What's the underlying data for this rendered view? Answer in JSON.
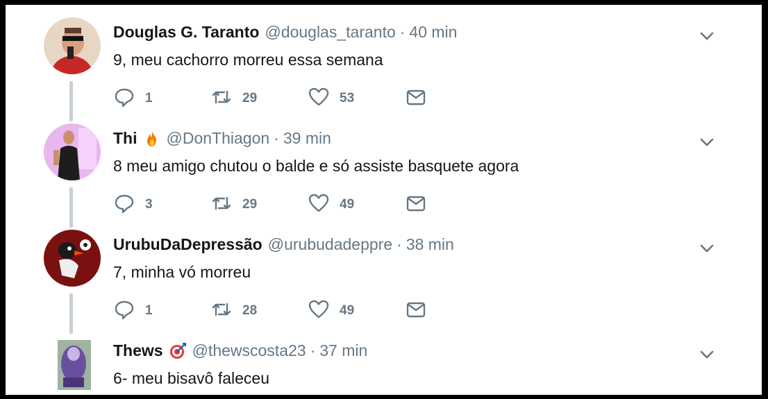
{
  "tweets": [
    {
      "name": "Douglas G. Taranto",
      "handle": "@douglas_taranto",
      "separator": "·",
      "time": "40 min",
      "text": "9, meu cachorro morreu essa semana",
      "replies": "1",
      "retweets": "29",
      "likes": "53",
      "badge": null
    },
    {
      "name": "Thi",
      "handle": "@DonThiagon",
      "separator": "·",
      "time": "39 min",
      "text": "8 meu amigo chutou o balde e só assiste basquete agora",
      "replies": "3",
      "retweets": "29",
      "likes": "49",
      "badge": "fire-emoji-icon"
    },
    {
      "name": "UrubuDaDepressão",
      "handle": "@urubudadeppre",
      "separator": "·",
      "time": "38 min",
      "text": "7, minha vó morreu",
      "replies": "1",
      "retweets": "28",
      "likes": "49",
      "badge": null
    },
    {
      "name": "Thews",
      "handle": "@thewscosta23",
      "separator": "·",
      "time": "37 min",
      "text": "6- meu bisavô faleceu",
      "badge": "target-emoji-icon"
    }
  ],
  "colors": {
    "accent_gray": "#657786",
    "text": "#14171a",
    "thread_line": "#c7d0d6"
  }
}
